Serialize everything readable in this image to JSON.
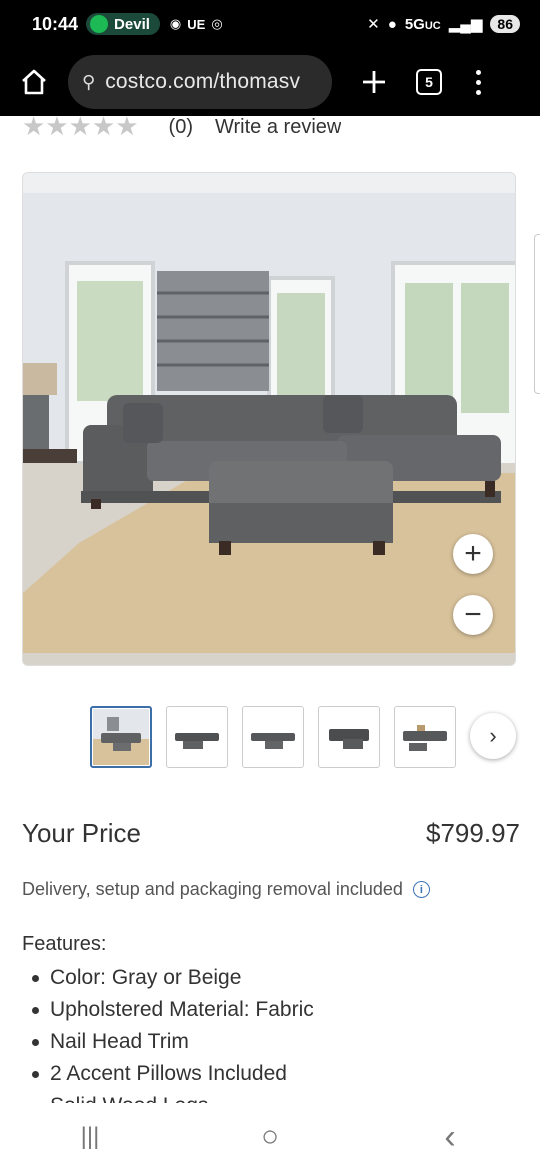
{
  "status_bar": {
    "time": "10:44",
    "spotify_label": "Devil",
    "left_icons": "UE",
    "network": "5G",
    "network_sub": "UC",
    "battery": "86"
  },
  "browser": {
    "url": "costco.com/thomasv",
    "tab_count": "5"
  },
  "rating": {
    "stars": "★★★★★",
    "count": "(0)",
    "write_review": "Write a review"
  },
  "gallery": {
    "zoom_in": "+",
    "zoom_out": "−",
    "next_arrow": "›",
    "thumbnail_count": 5,
    "active_thumbnail": 1
  },
  "price": {
    "label": "Your Price",
    "value": "$799.97"
  },
  "delivery": {
    "text": "Delivery, setup and packaging removal included",
    "info": "i"
  },
  "features": {
    "title": "Features:",
    "items": [
      "Color: Gray or Beige",
      "Upholstered Material: Fabric",
      "Nail Head Trim",
      "2 Accent Pillows Included",
      "Solid Wood Legs"
    ]
  },
  "navbar": {
    "recents": "|||",
    "home": "○",
    "back": "‹"
  }
}
